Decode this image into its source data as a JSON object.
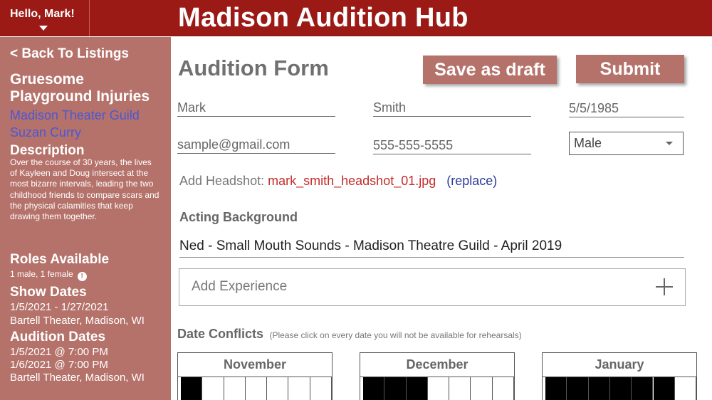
{
  "header": {
    "greeting": "Hello, Mark!",
    "app_title": "Madison Audition Hub",
    "colors": {
      "bar": "#9b1a16",
      "sidebar": "#b5726a",
      "link": "#4a57d6"
    }
  },
  "sidebar": {
    "back_label": "< Back To Listings",
    "show_title": "Gruesome Playground Injuries",
    "organization": "Madison Theater Guild",
    "director": "Suzan Curry",
    "description_heading": "Description",
    "description": "Over the course of 30 years, the lives of Kayleen and Doug intersect at the most bizarre intervals, leading the two childhood friends to compare scars and the physical calamities that keep drawing them together.",
    "roles_heading": "Roles Available",
    "roles": "1 male, 1 female",
    "roles_icon": "!",
    "show_dates_heading": "Show Dates",
    "show_dates": "1/5/2021 - 1/27/2021",
    "show_venue": "Bartell Theater, Madison, WI",
    "audition_dates_heading": "Audition Dates",
    "audition_dates": [
      "1/5/2021 @ 7:00 PM",
      "1/6/2021 @ 7:00 PM"
    ],
    "audition_venue": "Bartell Theater, Madison, WI"
  },
  "form": {
    "title": "Audition Form",
    "save_draft_label": "Save as draft",
    "submit_label": "Submit",
    "first_name": "Mark",
    "last_name": "Smith",
    "dob": "5/5/1985",
    "email": "sample@gmail.com",
    "phone": "555-555-5555",
    "gender": "Male",
    "headshot_label": "Add Headshot:",
    "headshot_file": "mark_smith_headshot_01.jpg",
    "headshot_replace": "(replace)",
    "acting_heading": "Acting Background",
    "acting_entry": "Ned - Small Mouth Sounds - Madison Theatre Guild - April 2019",
    "add_experience_placeholder": "Add Experience",
    "conflicts_heading": "Date Conflicts",
    "conflicts_note": "(Please click on every date you will not be available for rehearsals)",
    "calendars": [
      {
        "month": "November",
        "filled_days": [
          1
        ]
      },
      {
        "month": "December",
        "filled_days": [
          1,
          2,
          3
        ]
      },
      {
        "month": "January",
        "filled_days": [
          1,
          2,
          3,
          4,
          5,
          6
        ]
      }
    ]
  }
}
